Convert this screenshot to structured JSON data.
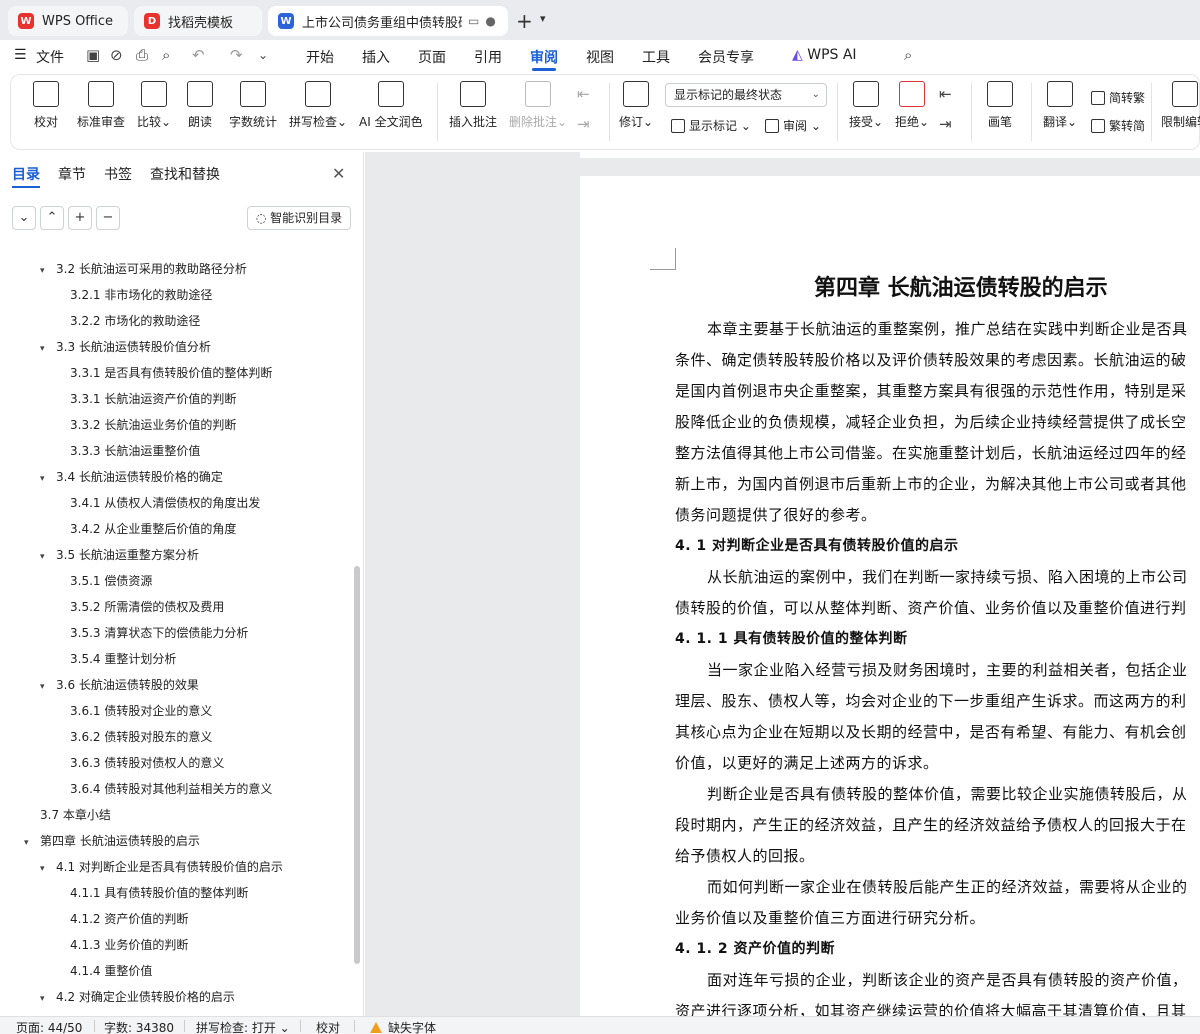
{
  "tabs": [
    {
      "label": "WPS Office",
      "icon": "wps-logo-icon"
    },
    {
      "label": "找稻壳模板",
      "icon": "docer-icon"
    },
    {
      "label": "上市公司债务重组中债转股研究",
      "icon": "writer-icon"
    }
  ],
  "menu": {
    "file": "文件",
    "items": [
      "开始",
      "插入",
      "页面",
      "引用",
      "审阅",
      "视图",
      "工具",
      "会员专享"
    ],
    "active": "审阅",
    "ai": "WPS AI"
  },
  "ribbon": {
    "proofread": "校对",
    "standard_review": "标准审查",
    "compare": "比较",
    "read_aloud": "朗读",
    "word_count": "字数统计",
    "spell_check": "拼写检查",
    "ai_polish": "AI 全文润色",
    "insert_comment": "插入批注",
    "delete_comment": "删除批注",
    "track_changes": "修订",
    "markup_dropdown": "显示标记的最终状态",
    "show_markup": "显示标记",
    "review": "审阅",
    "accept": "接受",
    "reject": "拒绝",
    "ink": "画笔",
    "translate": "翻译",
    "to_traditional": "简转繁",
    "to_simplified": "繁转简",
    "restrict_edit": "限制编辑"
  },
  "panel": {
    "tabs": [
      "目录",
      "章节",
      "书签",
      "查找和替换"
    ],
    "smart_button": "智能识别目录"
  },
  "toc": [
    {
      "level": 2,
      "caret": "▾",
      "text": "3.2 长航油运可采用的救助路径分析"
    },
    {
      "level": 3,
      "caret": "",
      "text": "3.2.1 非市场化的救助途径"
    },
    {
      "level": 3,
      "caret": "",
      "text": "3.2.2 市场化的救助途径"
    },
    {
      "level": 2,
      "caret": "▾",
      "text": "3.3 长航油运债转股价值分析"
    },
    {
      "level": 3,
      "caret": "",
      "text": "3.3.1 是否具有债转股价值的整体判断"
    },
    {
      "level": 3,
      "caret": "",
      "text": "3.3.1 长航油运资产价值的判断"
    },
    {
      "level": 3,
      "caret": "",
      "text": "3.3.2 长航油运业务价值的判断"
    },
    {
      "level": 3,
      "caret": "",
      "text": "3.3.3 长航油运重整价值"
    },
    {
      "level": 2,
      "caret": "▾",
      "text": "3.4 长航油运债转股价格的确定"
    },
    {
      "level": 3,
      "caret": "",
      "text": "3.4.1 从债权人清偿债权的角度出发"
    },
    {
      "level": 3,
      "caret": "",
      "text": "3.4.2 从企业重整后价值的角度"
    },
    {
      "level": 2,
      "caret": "▾",
      "text": "3.5 长航油运重整方案分析"
    },
    {
      "level": 3,
      "caret": "",
      "text": "3.5.1 偿债资源"
    },
    {
      "level": 3,
      "caret": "",
      "text": "3.5.2 所需清偿的债权及费用"
    },
    {
      "level": 3,
      "caret": "",
      "text": "3.5.3 清算状态下的偿债能力分析"
    },
    {
      "level": 3,
      "caret": "",
      "text": "3.5.4 重整计划分析"
    },
    {
      "level": 2,
      "caret": "▾",
      "text": "3.6 长航油运债转股的效果"
    },
    {
      "level": 3,
      "caret": "",
      "text": "3.6.1 债转股对企业的意义"
    },
    {
      "level": 3,
      "caret": "",
      "text": "3.6.2 债转股对股东的意义"
    },
    {
      "level": 3,
      "caret": "",
      "text": "3.6.3 债转股对债权人的意义"
    },
    {
      "level": 3,
      "caret": "",
      "text": "3.6.4 债转股对其他利益相关方的意义"
    },
    {
      "level": 2,
      "caret": "",
      "text": "3.7 本章小结"
    },
    {
      "level": 1,
      "caret": "▾",
      "text": "第四章 长航油运债转股的启示"
    },
    {
      "level": 2,
      "caret": "▾",
      "text": "4.1 对判断企业是否具有债转股价值的启示"
    },
    {
      "level": 3,
      "caret": "",
      "text": "4.1.1 具有债转股价值的整体判断"
    },
    {
      "level": 3,
      "caret": "",
      "text": "4.1.2 资产价值的判断"
    },
    {
      "level": 3,
      "caret": "",
      "text": "4.1.3 业务价值的判断"
    },
    {
      "level": 3,
      "caret": "",
      "text": "4.1.4 重整价值"
    },
    {
      "level": 2,
      "caret": "▾",
      "text": "4.2 对确定企业债转股价格的启示"
    }
  ],
  "document": {
    "title": "第四章  长航油运债转股的启示",
    "lines": [
      {
        "bold": false,
        "indent": true,
        "text": "本章主要基于长航油运的重整案例，推广总结在实践中判断企业是否具"
      },
      {
        "bold": false,
        "indent": false,
        "text": "条件、确定债转股转股价格以及评价债转股效果的考虑因素。长航油运的破"
      },
      {
        "bold": false,
        "indent": false,
        "text": "是国内首例退市央企重整案，其重整方案具有很强的示范性作用，特别是采"
      },
      {
        "bold": false,
        "indent": false,
        "text": "股降低企业的负债规模，减轻企业负担，为后续企业持续经营提供了成长空"
      },
      {
        "bold": false,
        "indent": false,
        "text": "整方法值得其他上市公司借鉴。在实施重整计划后，长航油运经过四年的经"
      },
      {
        "bold": false,
        "indent": false,
        "text": "新上市，为国内首例退市后重新上市的企业，为解决其他上市公司或者其他"
      },
      {
        "bold": false,
        "indent": false,
        "text": "债务问题提供了很好的参考。"
      },
      {
        "bold": true,
        "indent": false,
        "text": "4. 1 对判断企业是否具有债转股价值的启示"
      },
      {
        "bold": false,
        "indent": true,
        "text": "从长航油运的案例中，我们在判断一家持续亏损、陷入困境的上市公司"
      },
      {
        "bold": false,
        "indent": false,
        "text": "债转股的价值，可以从整体判断、资产价值、业务价值以及重整价值进行判"
      },
      {
        "bold": true,
        "indent": false,
        "text": "4. 1. 1 具有债转股价值的整体判断"
      },
      {
        "bold": false,
        "indent": true,
        "text": "当一家企业陷入经营亏损及财务困境时，主要的利益相关者，包括企业"
      },
      {
        "bold": false,
        "indent": false,
        "text": "理层、股东、债权人等，均会对企业的下一步重组产生诉求。而这两方的利"
      },
      {
        "bold": false,
        "indent": false,
        "text": "其核心点为企业在短期以及长期的经营中，是否有希望、有能力、有机会创"
      },
      {
        "bold": false,
        "indent": false,
        "text": "价值，以更好的满足上述两方的诉求。"
      },
      {
        "bold": false,
        "indent": true,
        "text": "判断企业是否具有债转股的整体价值，需要比较企业实施债转股后，从"
      },
      {
        "bold": false,
        "indent": false,
        "text": "段时期内，产生正的经济效益，且产生的经济效益给予债权人的回报大于在"
      },
      {
        "bold": false,
        "indent": false,
        "text": "给予债权人的回报。"
      },
      {
        "bold": false,
        "indent": true,
        "text": "而如何判断一家企业在债转股后能产生正的经济效益，需要将从企业的"
      },
      {
        "bold": false,
        "indent": false,
        "text": "业务价值以及重整价值三方面进行研究分析。"
      },
      {
        "bold": true,
        "indent": false,
        "text": "4. 1. 2 资产价值的判断"
      },
      {
        "bold": false,
        "indent": true,
        "text": "面对连年亏损的企业，判断该企业的资产是否具有债转股的资产价值，"
      },
      {
        "bold": false,
        "indent": false,
        "text": "资产进行逐项分析，如其资产继续运营的价值将大幅高于其清算价值，且其"
      }
    ]
  },
  "status": {
    "page": "页面: 44/50",
    "words": "字数: 34380",
    "spell": "拼写检查: 打开",
    "proof": "校对",
    "missing_font": "缺失字体"
  }
}
